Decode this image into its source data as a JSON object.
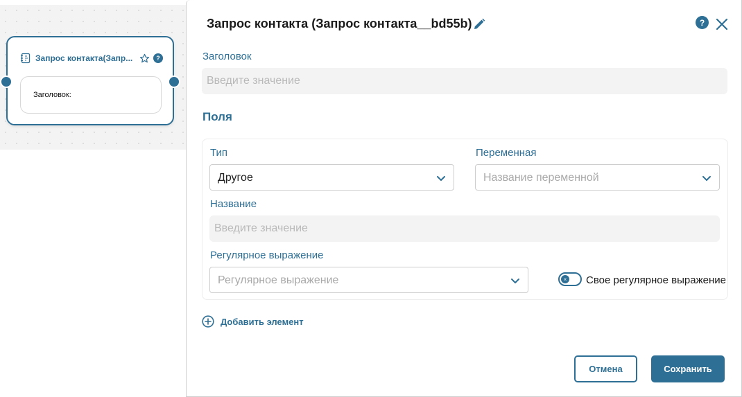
{
  "node": {
    "title": "Запрос контакта(Запр...",
    "help": "?",
    "body_text": "Заголовок:"
  },
  "dialog": {
    "title": "Запрос контакта (Запрос контакта__bd55b)",
    "help": "?",
    "header_label": "Заголовок",
    "header_placeholder": "Введите значение",
    "section_title": "Поля",
    "fields": {
      "type_label": "Тип",
      "type_value": "Другое",
      "variable_label": "Переменная",
      "variable_placeholder": "Название переменной",
      "name_label": "Название",
      "name_placeholder": "Введите значение",
      "regex_label": "Регулярное выражение",
      "regex_placeholder": "Регулярное выражение",
      "custom_regex_label": "Свое регулярное выражение",
      "custom_regex_enabled": false
    },
    "add_element": "Добавить элемент",
    "cancel_label": "Отмена",
    "save_label": "Сохранить"
  },
  "colors": {
    "accent": "#2e6f95",
    "field_bg": "#f3f3f3",
    "canvas_bg": "#f3f3f3"
  }
}
